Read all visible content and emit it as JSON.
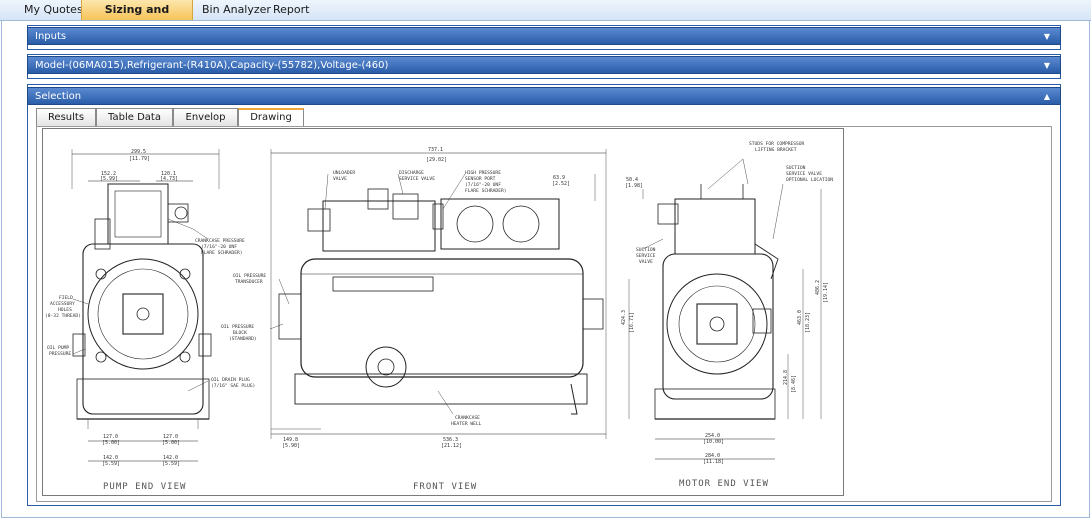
{
  "nav": {
    "items": [
      "My Quotes",
      "Sizing and Selection",
      "Bin Analyzer",
      "Report"
    ],
    "active": 1
  },
  "panels": {
    "inputs": "Inputs",
    "model": "Model-(06MA015),Refrigerant-(R410A),Capacity-(55782),Voltage-(460)",
    "selection": "Selection"
  },
  "tabs": [
    "Results",
    "Table Data",
    "Envelop",
    "Drawing"
  ],
  "active_tab": 3,
  "drawing": {
    "views": [
      "PUMP END VIEW",
      "FRONT VIEW",
      "MOTOR END VIEW"
    ],
    "labels": {
      "crankcase_pressure": [
        "CRANKCASE PRESSURE",
        "(7/16\"-20 UNF",
        "FLARE SCHRADER)"
      ],
      "field_holes": [
        "FIELD",
        "ACCESSORY",
        "HOLES",
        "(8-32 THREAD)"
      ],
      "oil_pump": [
        "OIL PUMP",
        "PRESSURE"
      ],
      "oil_drain": [
        "OIL DRAIN PLUG",
        "(7/16\" SAE PLUG)"
      ],
      "unloader": [
        "UNLOADER",
        "VALVE"
      ],
      "discharge": [
        "DISCHARGE",
        "SERVICE VALVE"
      ],
      "hp_sensor": [
        "HIGH PRESSURE",
        "SENSOR PORT",
        "(7/16\"-20 UNF",
        "FLARE SCHRADER)"
      ],
      "oil_transducer": [
        "OIL PRESSURE",
        "TRANSDUCER"
      ],
      "oil_block": [
        "OIL PRESSURE",
        "BLOCK",
        "(STANDARD)"
      ],
      "crankcase_heater": [
        "CRANKCASE",
        "HEATER WELL"
      ],
      "studs": [
        "STUDS FOR COMPRESSOR",
        "LIFTING BRACKET"
      ],
      "suction_opt": [
        "SUCTION",
        "SERVICE VALVE",
        "OPTIONAL LOCATION"
      ],
      "suction": [
        "SUCTION",
        "SERVICE",
        "VALVE"
      ]
    },
    "dims": {
      "pump_w": [
        "299.5",
        "[11.79]"
      ],
      "pump_l": [
        "152.2",
        "[5.99]"
      ],
      "pump_r": [
        "120.1",
        "[4.73]"
      ],
      "pump_b1": [
        "127.0",
        "[5.00]"
      ],
      "pump_b2": [
        "127.0",
        "[5.00]"
      ],
      "pump_b3": [
        "142.0",
        "[5.59]"
      ],
      "pump_b4": [
        "142.0",
        "[5.59]"
      ],
      "front_w": [
        "737.1",
        "[29.02]"
      ],
      "front_h": [
        "63.9",
        "[2.52]"
      ],
      "front_b1": [
        "149.8",
        "[5.90]"
      ],
      "front_b2": [
        "536.3",
        "[21.12]"
      ],
      "motor_top": [
        "50.4",
        "[1.98]"
      ],
      "motor_h1": [
        "424.3",
        "[16.71]"
      ],
      "motor_h2": [
        "486.2",
        "[19.14]"
      ],
      "motor_h3": [
        "463.0",
        "[18.23]"
      ],
      "motor_h4": [
        "214.8",
        "[8.46]"
      ],
      "motor_b1": [
        "254.0",
        "[10.00]"
      ],
      "motor_b2": [
        "284.0",
        "[11.18]"
      ]
    }
  }
}
